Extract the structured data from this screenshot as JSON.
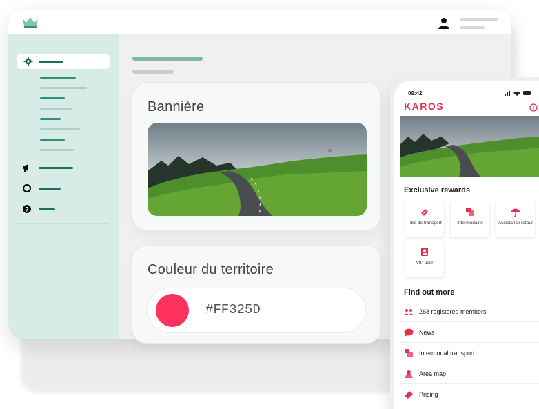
{
  "colors": {
    "accent": "#FF325D",
    "sidebar": "#d8ece7",
    "brand": "#e7304f",
    "primary": "#1f6e5a"
  },
  "admin": {
    "logo_icon": "crown-icon",
    "user_icon": "user-icon",
    "sidebar_icons": [
      "gear-icon",
      "megaphone-icon",
      "circle-icon",
      "help-icon"
    ],
    "banner_label": "Bannière",
    "color_label": "Couleur du territoire",
    "color_value": "#FF325D"
  },
  "phone": {
    "time": "09:42",
    "brand": "KAROS",
    "rewards_title": "Exclusive rewards",
    "rewards": [
      {
        "label": "Titre de transport",
        "icon": "ticket-icon"
      },
      {
        "label": "Intermodalité",
        "icon": "bus-icon"
      },
      {
        "label": "Assistance retour",
        "icon": "umbrella-icon"
      },
      {
        "label": "VIP user",
        "icon": "badge-icon"
      }
    ],
    "more_title": "Find out more",
    "links": [
      {
        "label": "268 registered members",
        "icon": "members-icon"
      },
      {
        "label": "News",
        "icon": "chat-icon"
      },
      {
        "label": "Intermodal transport",
        "icon": "bus-icon"
      },
      {
        "label": "Area map",
        "icon": "map-icon"
      },
      {
        "label": "Pricing",
        "icon": "ticket-icon"
      }
    ]
  }
}
